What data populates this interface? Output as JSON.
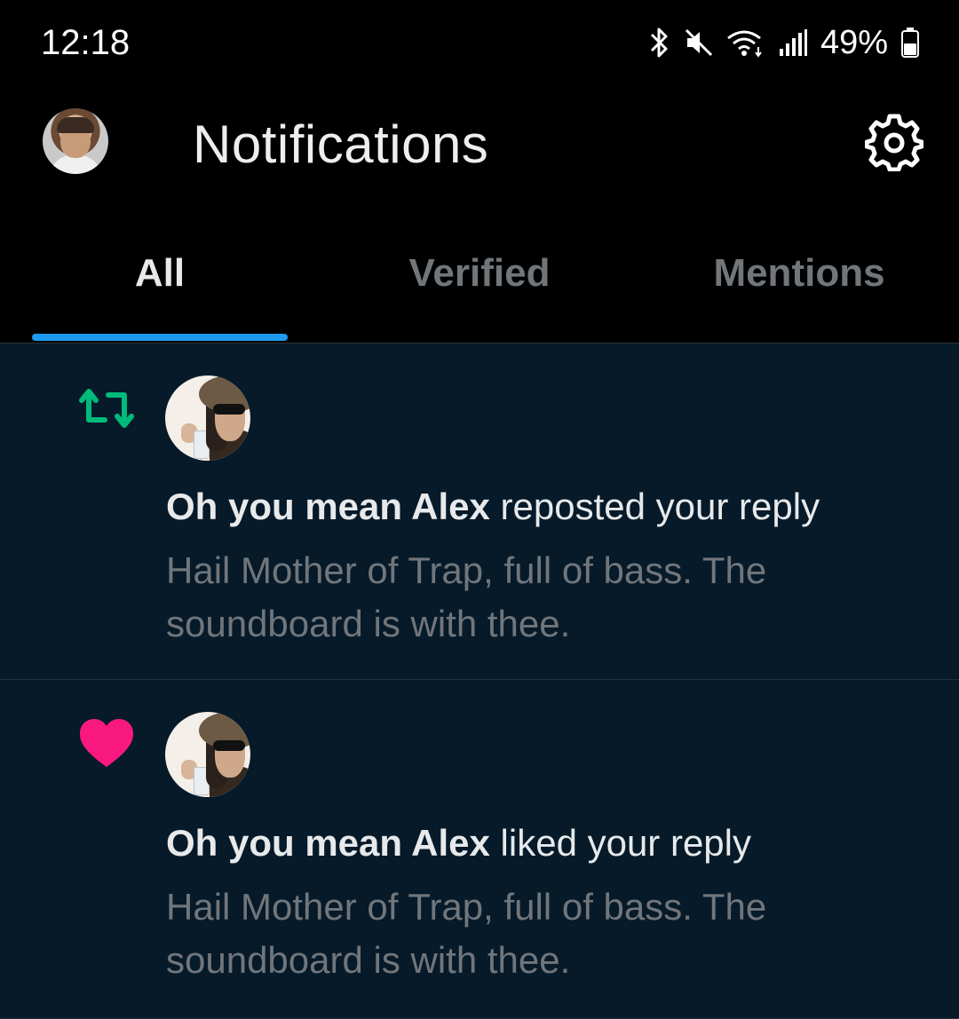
{
  "status_bar": {
    "time": "12:18",
    "battery": "49%"
  },
  "header": {
    "title": "Notifications"
  },
  "tabs": [
    {
      "label": "All",
      "active": true
    },
    {
      "label": "Verified",
      "active": false
    },
    {
      "label": "Mentions",
      "active": false
    }
  ],
  "notifications": [
    {
      "type": "repost",
      "icon": "repost-icon",
      "user_name": "Oh you mean Alex",
      "action": " reposted your reply",
      "text": "Hail Mother of Trap, full of bass. The soundboard is with thee."
    },
    {
      "type": "like",
      "icon": "heart-icon",
      "user_name": "Oh you mean Alex",
      "action": " liked your reply",
      "text": "Hail Mother of Trap, full of bass. The soundboard is with thee."
    }
  ],
  "colors": {
    "accent": "#1d9bf0",
    "repost": "#00ba7c",
    "like": "#f91880",
    "list_bg": "#061a29"
  }
}
